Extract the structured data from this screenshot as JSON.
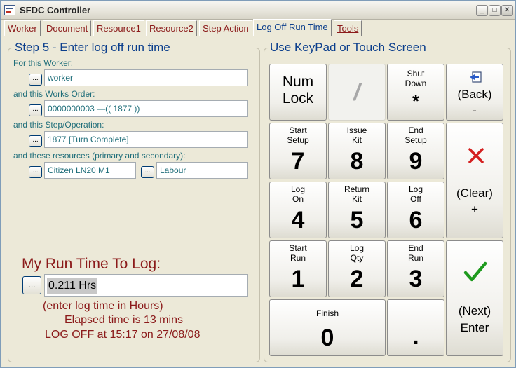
{
  "window": {
    "title": "SFDC Controller",
    "minimize": "_",
    "maximize": "□",
    "close": "✕"
  },
  "tabs": [
    {
      "label": "Worker"
    },
    {
      "label": "Document"
    },
    {
      "label": "Resource1"
    },
    {
      "label": "Resource2"
    },
    {
      "label": "Step Action"
    },
    {
      "label": "Log Off Run Time",
      "active": true
    },
    {
      "label": "Tools"
    }
  ],
  "step": {
    "title": "Step 5 - Enter log off run time",
    "worker_label": "For this Worker:",
    "worker_value": "worker",
    "order_label": "and this Works Order:",
    "order_value": "0000000003    —(( 1877 ))",
    "operation_label": "and this Step/Operation:",
    "operation_value": "1877 [Turn Complete]",
    "resources_label": "and these resources (primary and secondary):",
    "resource_primary": "Citizen LN20 M1",
    "resource_secondary": "Labour",
    "browse_label": "...",
    "runtime_label": "My Run Time To Log:",
    "runtime_value": "0.211 Hrs",
    "hint": "(enter log time in Hours)",
    "elapsed": "Elapsed time is 13 mins",
    "logoff": "LOG OFF at 15:17 on 27/08/08"
  },
  "keypad": {
    "title": "Use KeyPad or Touch Screen",
    "numlock_line1": "Num",
    "numlock_line2": "Lock",
    "numlock_sub": ".....",
    "slash": "/",
    "shutdown_top1": "Shut",
    "shutdown_top2": "Down",
    "shutdown_key": "*",
    "back_label": "(Back)",
    "back_key": "-",
    "clear_label": "(Clear)",
    "clear_key": "+",
    "next_label": "(Next)",
    "next_key": "Enter",
    "k7_1": "Start",
    "k7_2": "Setup",
    "k7": "7",
    "k8_1": "Issue",
    "k8_2": "Kit",
    "k8": "8",
    "k9_1": "End",
    "k9_2": "Setup",
    "k9": "9",
    "k4_1": "Log",
    "k4_2": "On",
    "k4": "4",
    "k5_1": "Return",
    "k5_2": "Kit",
    "k5": "5",
    "k6_1": "Log",
    "k6_2": "Off",
    "k6": "6",
    "k1_1": "Start",
    "k1_2": "Run",
    "k1": "1",
    "k2_1": "Log",
    "k2_2": "Qty",
    "k2": "2",
    "k3_1": "End",
    "k3_2": "Run",
    "k3": "3",
    "k0_1": "Finish",
    "k0": "0",
    "kdot": "."
  },
  "colors": {
    "accent_blue": "#0B3E8C",
    "dark_red": "#8B1A1A",
    "teal_text": "#1F6E7A",
    "clear_red": "#D42020",
    "check_green": "#1E9A1E"
  }
}
